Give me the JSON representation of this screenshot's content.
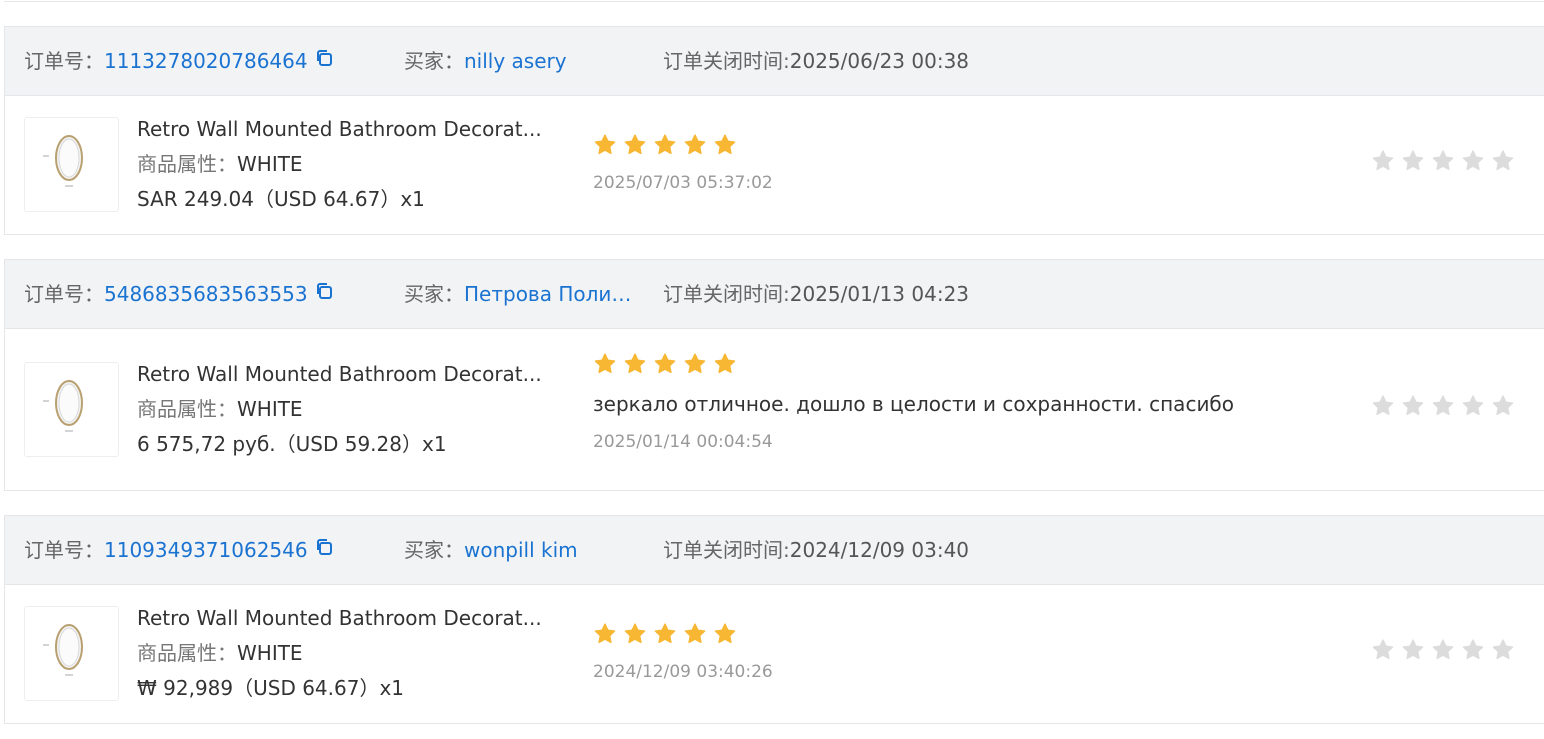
{
  "labels": {
    "order_no": "订单号：",
    "buyer": "买家：",
    "close_time": "订单关闭时间:",
    "attr": "商品属性："
  },
  "orders": [
    {
      "order_no": "1113278020786464",
      "buyer": "nilly asery",
      "close_time": "2025/06/23 00:38",
      "product": {
        "title": "Retro Wall Mounted Bathroom Decorat...",
        "attr_value": "WHITE",
        "price": "SAR 249.04（USD  64.67）x1"
      },
      "review": {
        "rating": 5,
        "text": "",
        "time": "2025/07/03 05:37:02"
      },
      "seller_rating": 0
    },
    {
      "order_no": "5486835683563553",
      "buyer": "Петрова Полин...",
      "close_time": "2025/01/13 04:23",
      "product": {
        "title": "Retro Wall Mounted Bathroom Decorat...",
        "attr_value": "WHITE",
        "price": "6 575,72 руб.（USD  59.28）x1"
      },
      "review": {
        "rating": 5,
        "text": "зеркало отличное. дошло в целости и сохранности. спасибо",
        "time": "2025/01/14 00:04:54"
      },
      "seller_rating": 0
    },
    {
      "order_no": "1109349371062546",
      "buyer": "wonpill kim",
      "close_time": "2024/12/09 03:40",
      "product": {
        "title": "Retro Wall Mounted Bathroom Decorat...",
        "attr_value": "WHITE",
        "price": "₩ 92,989（USD  64.67）x1"
      },
      "review": {
        "rating": 5,
        "text": "",
        "time": "2024/12/09 03:40:26"
      },
      "seller_rating": 0
    }
  ],
  "colors": {
    "link": "#1a73d1",
    "star_filled": "#f7b733",
    "star_empty": "#dcdcdc",
    "header_bg": "#f2f3f5"
  },
  "icons": {
    "copy": "copy-icon",
    "star": "star-icon",
    "thumbnail": "oval-mirror-thumbnail"
  }
}
